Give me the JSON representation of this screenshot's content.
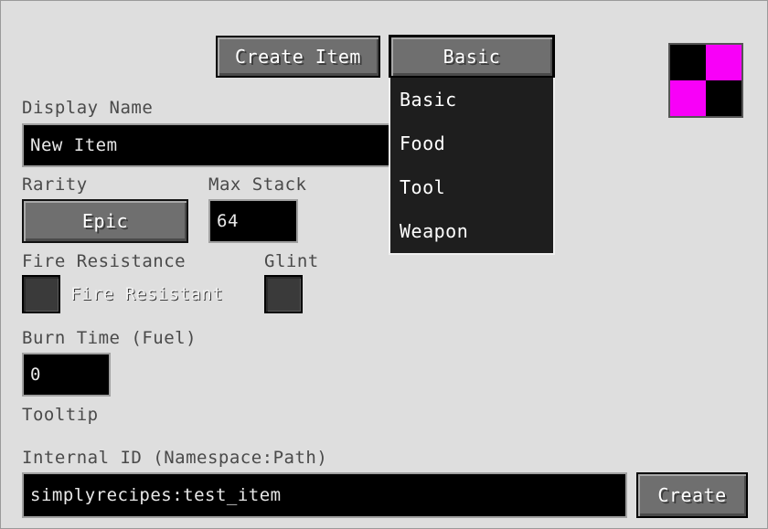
{
  "toolbar": {
    "create_item_label": "Create Item",
    "type_select_value": "Basic"
  },
  "type_dropdown": {
    "options": [
      "Basic",
      "Food",
      "Tool",
      "Weapon"
    ]
  },
  "preview_icon": {
    "name": "missing-texture-icon",
    "colors": [
      "#000000",
      "#f800f8"
    ]
  },
  "form": {
    "display_name_label": "Display Name",
    "display_name_value": "New Item",
    "rarity_label": "Rarity",
    "rarity_value": "Epic",
    "max_stack_label": "Max Stack",
    "max_stack_value": "64",
    "fire_resistance_label": "Fire Resistance",
    "fire_resistant_checkbox_label": "Fire Resistant",
    "glint_label": "Glint",
    "burn_time_label": "Burn Time (Fuel)",
    "burn_time_value": "0",
    "tooltip_label": "Tooltip",
    "internal_id_label": "Internal ID (Namespace:Path)",
    "internal_id_value": "simplyrecipes:test_item",
    "create_button_label": "Create"
  }
}
